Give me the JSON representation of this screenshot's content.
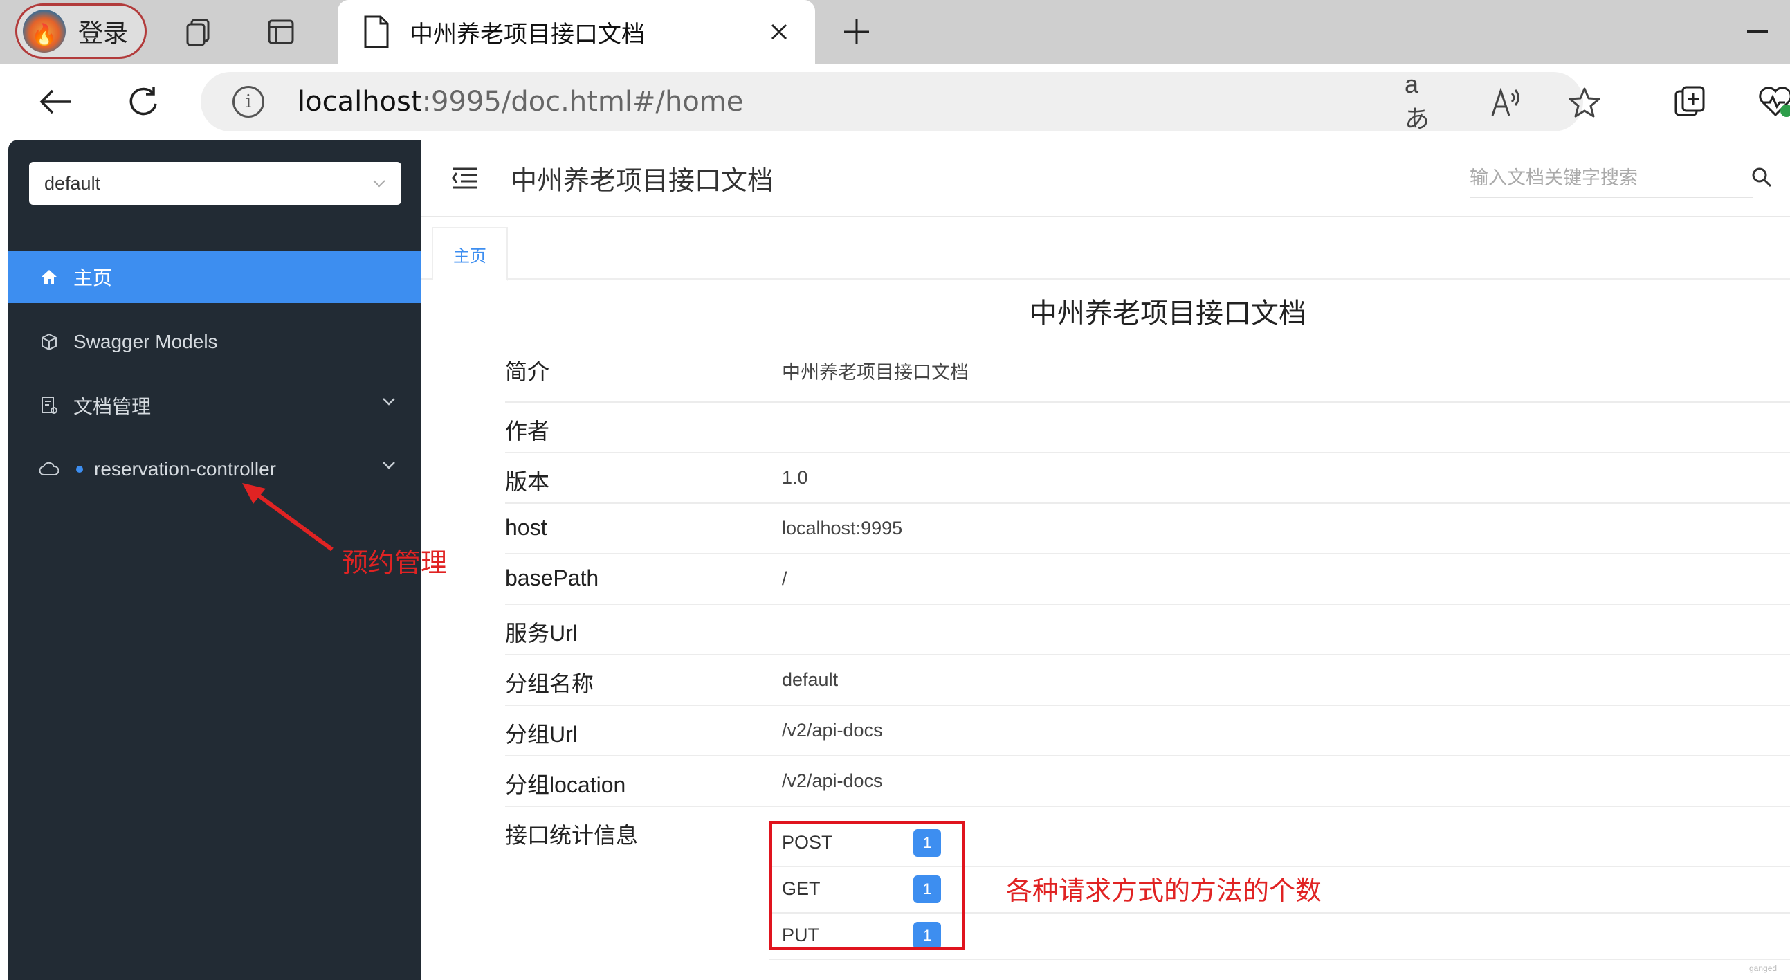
{
  "browser": {
    "profile_label": "登录",
    "tab_title": "中州养老项目接口文档",
    "url_host": "localhost",
    "url_rest": ":9995/doc.html#/home",
    "translate_glyph": "aあ",
    "read_aloud_glyph": "A",
    "info_glyph": "i"
  },
  "sidebar": {
    "group_select_value": "default",
    "items": [
      {
        "label": "主页",
        "icon": "home-icon",
        "active": true
      },
      {
        "label": "Swagger Models",
        "icon": "cube-icon",
        "active": false
      },
      {
        "label": "文档管理",
        "icon": "doc-manage-icon",
        "active": false
      },
      {
        "label": "reservation-controller",
        "icon": "cloud-icon",
        "active": false
      }
    ]
  },
  "annotations": {
    "sidebar_note": "预约管理",
    "stats_note": "各种请求方式的方法的个数"
  },
  "topbar": {
    "title": "中州养老项目接口文档",
    "search_placeholder": "输入文档关键字搜索"
  },
  "tabs": {
    "home": "主页"
  },
  "doc": {
    "title": "中州养老项目接口文档",
    "rows": [
      {
        "key": "简介",
        "value": "中州养老项目接口文档"
      },
      {
        "key": "作者",
        "value": ""
      },
      {
        "key": "版本",
        "value": "1.0"
      },
      {
        "key": "host",
        "value": "localhost:9995"
      },
      {
        "key": "basePath",
        "value": "/"
      },
      {
        "key": "服务Url",
        "value": ""
      },
      {
        "key": "分组名称",
        "value": "default"
      },
      {
        "key": "分组Url",
        "value": "/v2/api-docs"
      },
      {
        "key": "分组location",
        "value": "/v2/api-docs"
      },
      {
        "key": "接口统计信息",
        "value": ""
      }
    ],
    "stats": [
      {
        "method": "POST",
        "count": "1"
      },
      {
        "method": "GET",
        "count": "1"
      },
      {
        "method": "PUT",
        "count": "1"
      }
    ]
  },
  "colors": {
    "accent": "#3d8ef0",
    "sidebar_bg": "#222b34",
    "annotation_red": "#e02323"
  }
}
